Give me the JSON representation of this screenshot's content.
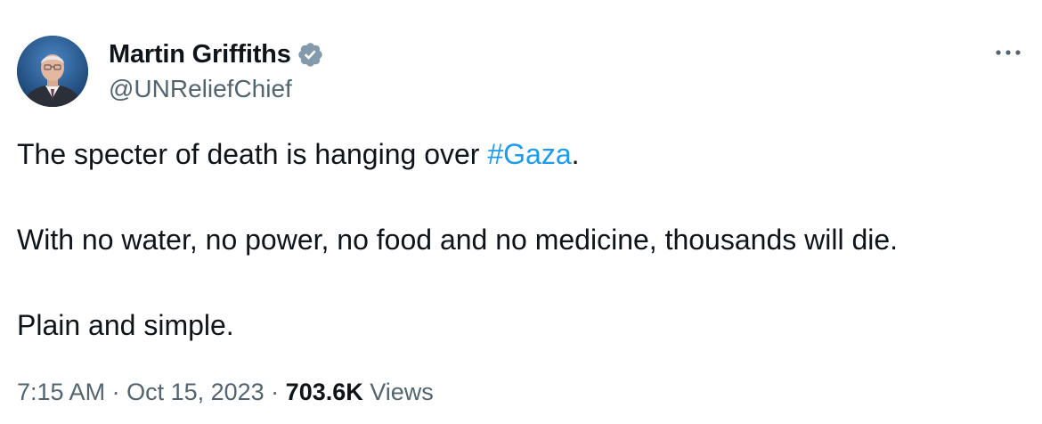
{
  "author": {
    "display_name": "Martin Griffiths",
    "handle": "@UNReliefChief",
    "verified": true
  },
  "tweet": {
    "line1_prefix": "The specter of death is hanging over ",
    "line1_hashtag": "#Gaza",
    "line1_suffix": ".",
    "line2": "With no water, no power, no food and no medicine, thousands will die.",
    "line3": "Plain and simple."
  },
  "meta": {
    "time": "7:15 AM",
    "sep1": " · ",
    "date": "Oct 15, 2023",
    "sep2": " · ",
    "view_count": "703.6K",
    "views_label": " Views"
  },
  "colors": {
    "accent": "#1d9bf0",
    "text": "#0f1419",
    "secondary": "#536471",
    "verified_badge": "#829aab"
  },
  "icons": {
    "verified": "verified-badge-icon",
    "more": "more-options-icon"
  }
}
